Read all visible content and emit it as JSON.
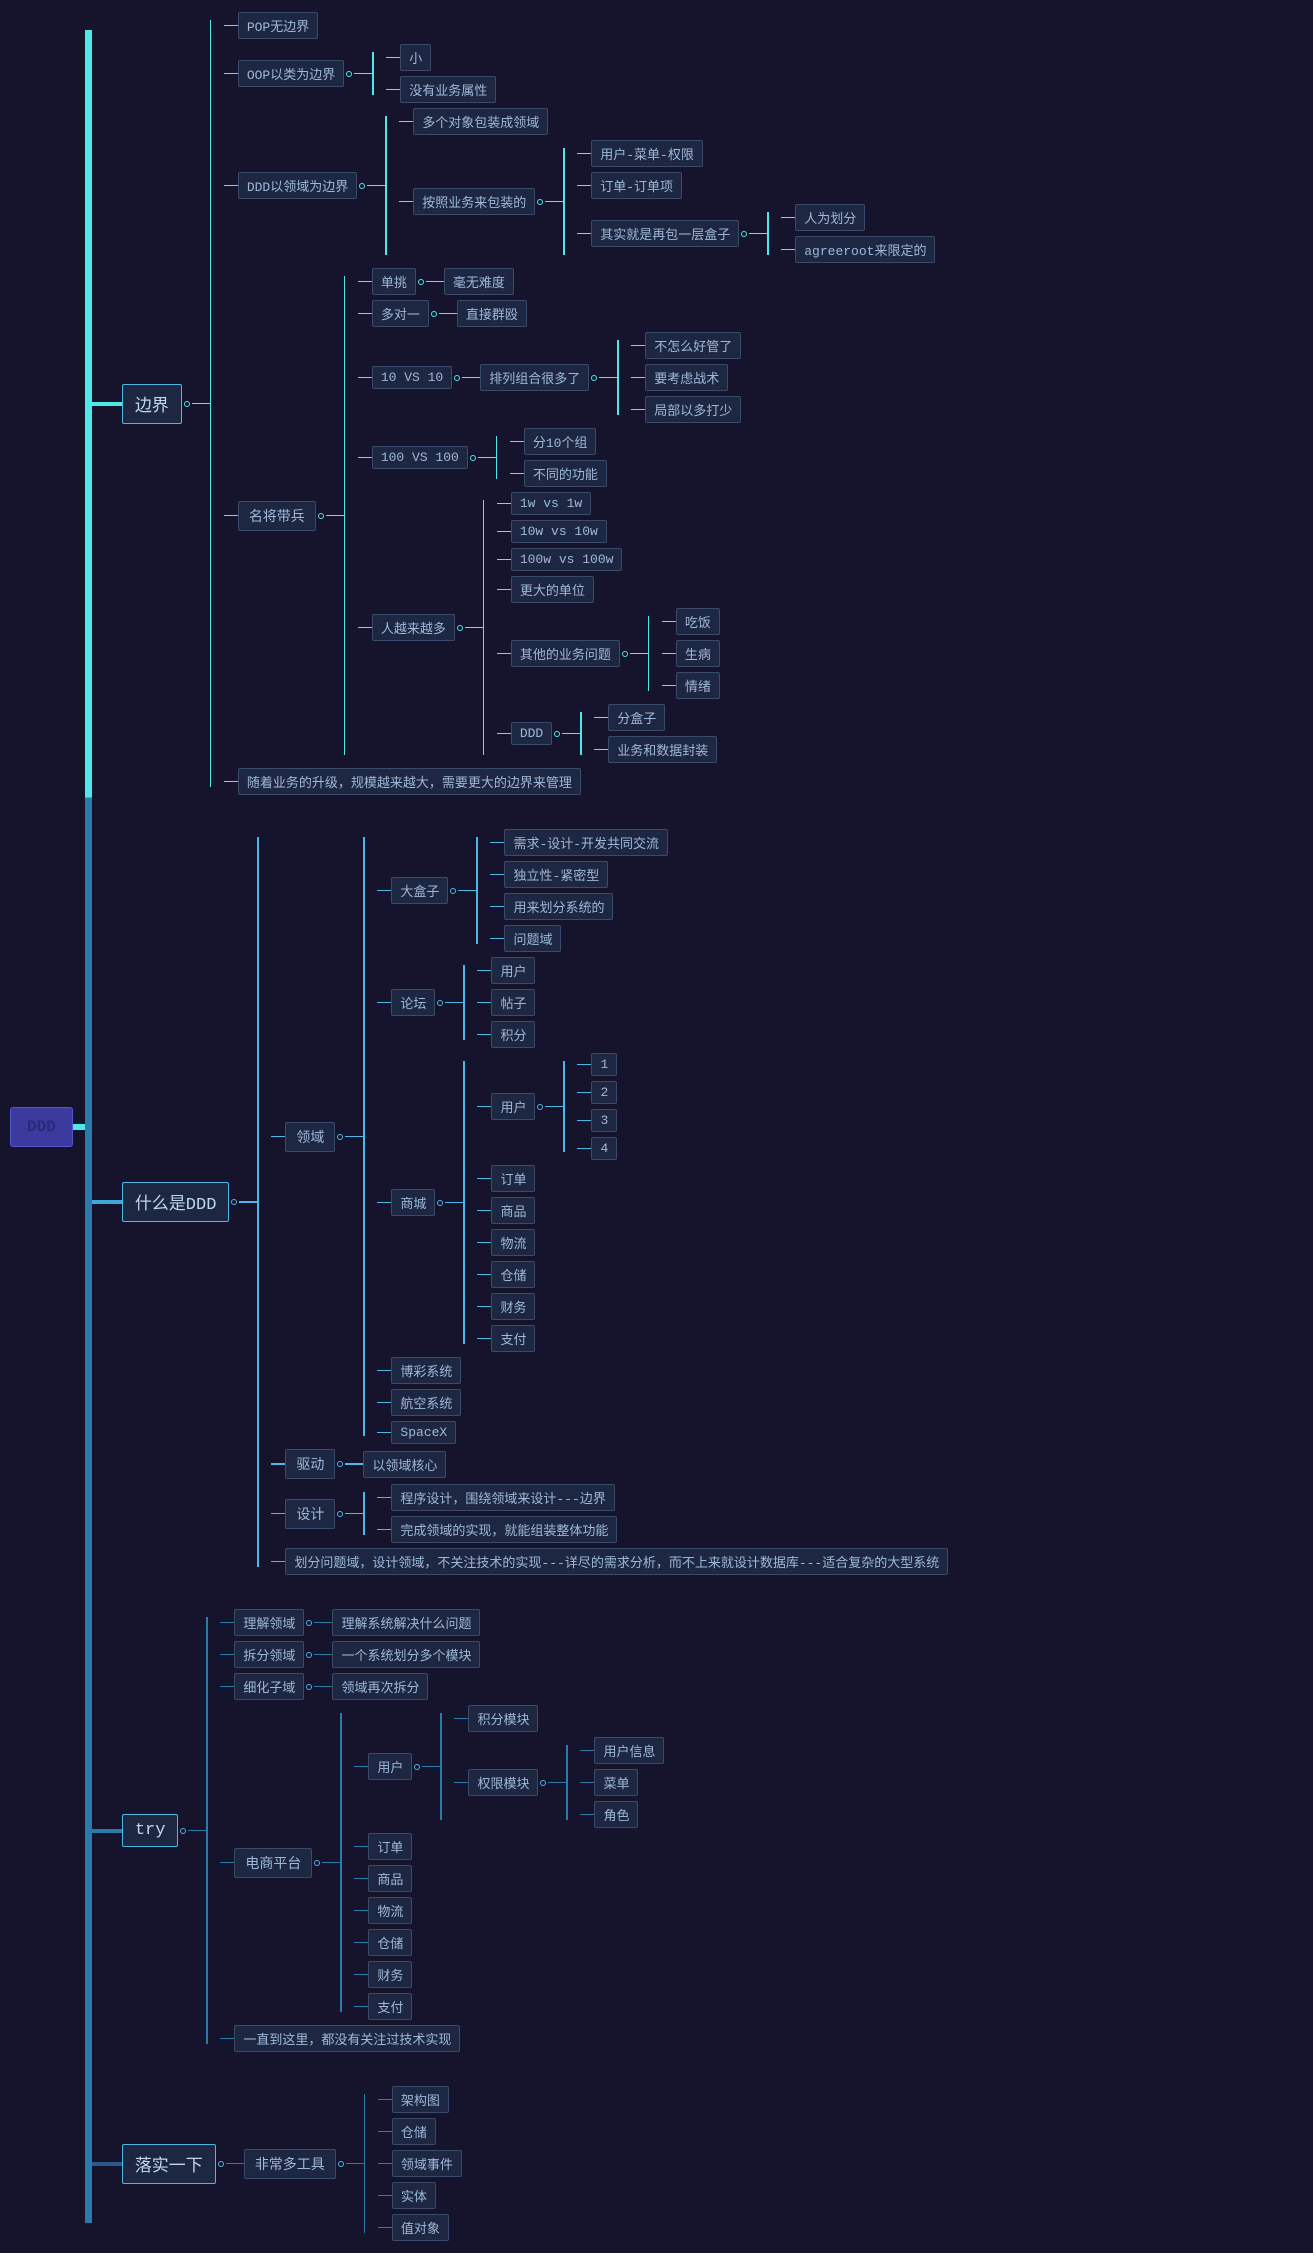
{
  "root": "DDD",
  "n": {
    "bj": "边界",
    "pop": "POP无边界",
    "oop": "OOP以类为边界",
    "oop1": "小",
    "oop2": "没有业务属性",
    "ddd1": "DDD以领域为边界",
    "ddd1a": "多个对象包装成领域",
    "ddd1b": "按照业务来包装的",
    "ddd1b1": "用户-菜单-权限",
    "ddd1b2": "订单-订单项",
    "ddd1b3": "其实就是再包一层盒子",
    "ddd1b3a": "人为划分",
    "ddd1b3b": "agreeroot来限定的",
    "mj": "名将带兵",
    "mj1": "单挑",
    "mj1a": "毫无难度",
    "mj2": "多对一",
    "mj2a": "直接群殴",
    "mj3": "10 VS 10",
    "mj3a": "排列组合很多了",
    "mj3a1": "不怎么好管了",
    "mj3a2": "要考虑战术",
    "mj3a3": "局部以多打少",
    "mj4": "100 VS 100",
    "mj4a": "分10个组",
    "mj4b": "不同的功能",
    "mj5": "人越来越多",
    "mj5a": "1w vs 1w",
    "mj5b": "10w vs 10w",
    "mj5c": "100w vs 100w",
    "mj5d": "更大的单位",
    "mj5e": "其他的业务问题",
    "mj5e1": "吃饭",
    "mj5e2": "生病",
    "mj5e3": "情绪",
    "mj5f": "DDD",
    "mj5f1": "分盒子",
    "mj5f2": "业务和数据封装",
    "bjsum": "随着业务的升级，规模越来越大，需要更大的边界来管理",
    "sm": "什么是DDD",
    "ly": "领域",
    "dhz": "大盒子",
    "dhz1": "需求-设计-开发共同交流",
    "dhz2": "独立性-紧密型",
    "dhz3": "用来划分系统的",
    "dhz4": "问题域",
    "lt": "论坛",
    "lt1": "用户",
    "lt2": "帖子",
    "lt3": "积分",
    "sc": "商城",
    "scyh": "用户",
    "scyh1": "1",
    "scyh2": "2",
    "scyh3": "3",
    "scyh4": "4",
    "sc1": "订单",
    "sc2": "商品",
    "sc3": "物流",
    "sc4": "仓储",
    "sc5": "财务",
    "sc6": "支付",
    "bc": "博彩系统",
    "hk": "航空系统",
    "sx": "SpaceX",
    "qd": "驱动",
    "qd1": "以领域核心",
    "sj": "设计",
    "sj1": "程序设计，围绕领域来设计---边界",
    "sj2": "完成领域的实现，就能组装整体功能",
    "smsum": "划分问题域，设计领域，不关注技术的实现---详尽的需求分析，而不上来就设计数据库---适合复杂的大型系统",
    "try": "try",
    "ljly": "理解领域",
    "ljly1": "理解系统解决什么问题",
    "cfly": "拆分领域",
    "cfly1": "一个系统划分多个模块",
    "xhzy": "细化子域",
    "xhzy1": "领域再次拆分",
    "dspt": "电商平台",
    "dsyh": "用户",
    "jfmk": "积分模块",
    "qxmk": "权限模块",
    "qxmk1": "用户信息",
    "qxmk2": "菜单",
    "qxmk3": "角色",
    "ds1": "订单",
    "ds2": "商品",
    "ds3": "物流",
    "ds4": "仓储",
    "ds5": "财务",
    "ds6": "支付",
    "trysum": "一直到这里，都没有关注过技术实现",
    "ls": "落实一下",
    "fcdgj": "非常多工具",
    "ls1": "架构图",
    "ls2": "仓储",
    "ls3": "领域事件",
    "ls4": "实体",
    "ls5": "值对象"
  }
}
